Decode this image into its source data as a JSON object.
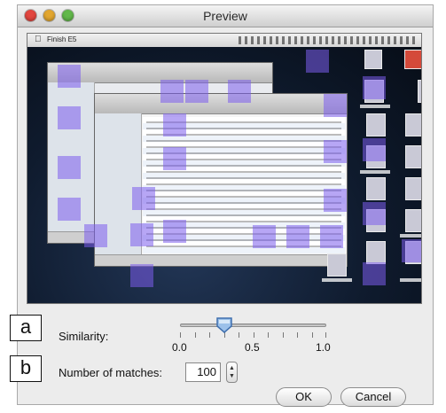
{
  "window": {
    "title": "Preview"
  },
  "screenshot": {
    "menubar_app": "Finish E5"
  },
  "callouts": {
    "a": "a",
    "b": "b"
  },
  "similarity": {
    "label": "Similarity:",
    "value": 0.3,
    "min": 0.0,
    "max": 1.0,
    "tick_labels": [
      "0.0",
      "0.5",
      "1.0"
    ]
  },
  "matches": {
    "label": "Number of matches:",
    "value": "100"
  },
  "buttons": {
    "ok": "OK",
    "cancel": "Cancel"
  },
  "colors": {
    "match_highlight": "#7c5cec",
    "desktop": "#0f1b2e",
    "window_bg": "#ececec"
  }
}
